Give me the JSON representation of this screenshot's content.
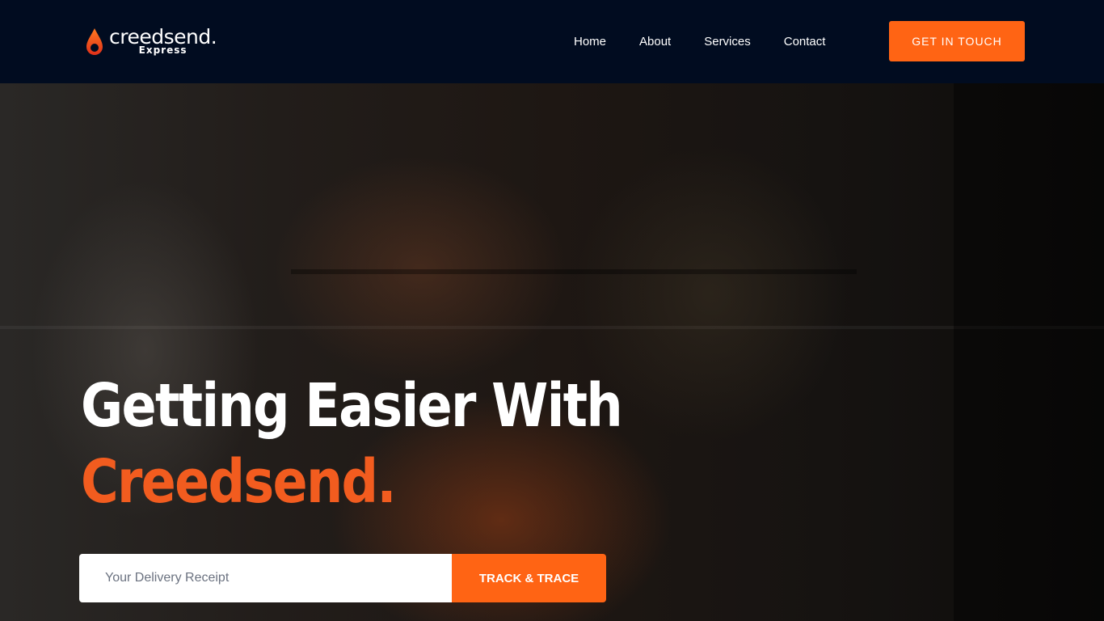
{
  "brand": {
    "name": "creedsend.",
    "sub": "Express"
  },
  "nav": {
    "items": [
      "Home",
      "About",
      "Services",
      "Contact"
    ],
    "cta": "GET IN TOUCH"
  },
  "hero": {
    "title_line1": "Getting Easier With",
    "title_line2": "Creedsend.",
    "track": {
      "placeholder": "Your Delivery Receipt",
      "value": "",
      "button": "TRACK & TRACE"
    }
  },
  "colors": {
    "accent": "#ff6414",
    "header_bg": "#010c20",
    "title_accent": "#f25c1f"
  }
}
